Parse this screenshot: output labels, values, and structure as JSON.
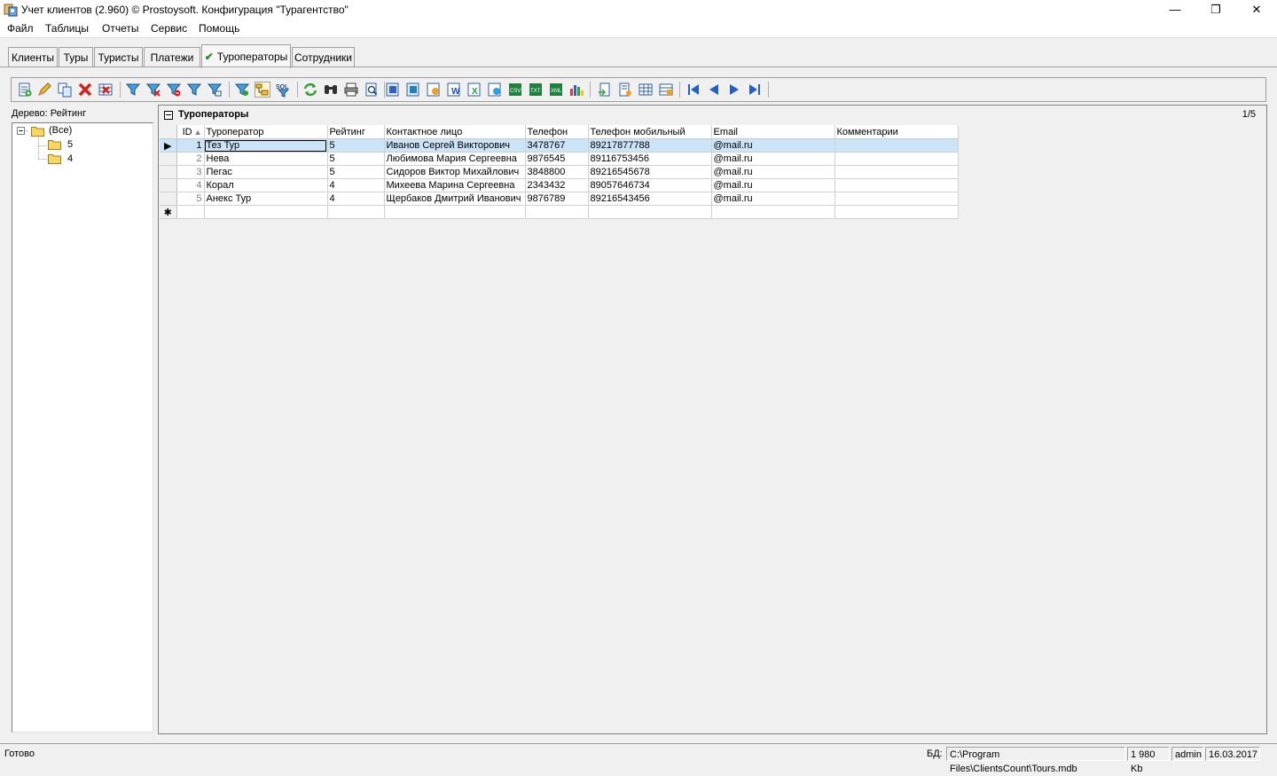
{
  "window": {
    "title": "Учет клиентов (2.960) © Prostoysoft. Конфигурация \"Турагентство\"",
    "minimize": "—",
    "maximize": "❐",
    "close": "✕"
  },
  "menu": [
    "Файл",
    "Таблицы",
    "Отчеты",
    "Сервис",
    "Помощь"
  ],
  "tabs": [
    {
      "label": "Клиенты",
      "active": false
    },
    {
      "label": "Туры",
      "active": false
    },
    {
      "label": "Туристы",
      "active": false
    },
    {
      "label": "Платежи",
      "active": false
    },
    {
      "label": "Туроператоры",
      "active": true
    },
    {
      "label": "Сотрудники",
      "active": false
    }
  ],
  "tab_check": "✔",
  "tree": {
    "label": "Дерево: Рейтинг",
    "root": "(Все)",
    "children": [
      "5",
      "4"
    ]
  },
  "grid": {
    "title": "Туроператоры",
    "count": "1/5",
    "columns": [
      "ID",
      "Туроператор",
      "Рейтинг",
      "Контактное лицо",
      "Телефон",
      "Телефон мобильный",
      "Email",
      "Комментарии"
    ],
    "sort_indicator": "▲",
    "rows": [
      [
        "1",
        "Тез Тур",
        "5",
        "Иванов Сергей Викторович",
        "3478767",
        "89217877788",
        "@mail.ru",
        ""
      ],
      [
        "2",
        "Нева",
        "5",
        "Любимова Мария Сергеевна",
        "9876545",
        "89116753456",
        "@mail.ru",
        ""
      ],
      [
        "3",
        "Пегас",
        "5",
        "Сидоров Виктор Михайлович",
        "3848800",
        "89216545678",
        "@mail.ru",
        ""
      ],
      [
        "4",
        "Корал",
        "4",
        "Михеева Марина Сергеевна",
        "2343432",
        "89057646734",
        "@mail.ru",
        ""
      ],
      [
        "5",
        "Анекс Тур",
        "4",
        "Щербаков Дмитрий Иванович",
        "9876789",
        "89216543456",
        "@mail.ru",
        ""
      ]
    ],
    "current_row_marker": "▶",
    "new_row_marker": "✱"
  },
  "status": {
    "ready": "Готово",
    "db_label": "БД:",
    "db_path": "C:\\Program Files\\ClientsCount\\Tours.mdb",
    "size": "1 980 Kb",
    "user": "admin",
    "date": "16.03.2017"
  },
  "toolbar_icons": [
    "add-record-icon",
    "edit-icon",
    "copy-icon",
    "delete-icon",
    "delete-all-icon",
    "filter-icon",
    "filter-remove-icon",
    "filter-clear-icon",
    "filter-advanced-icon",
    "filter-edit-icon",
    "filter-tree-icon",
    "tree-filter-icon",
    "sql-filter-icon",
    "refresh-icon",
    "find-icon",
    "print-icon",
    "preview-icon",
    "export-word-icon",
    "export-excel-icon",
    "export-html-icon",
    "export-csv-icon",
    "export-xml-icon",
    "export-txt-icon",
    "export-dbf-icon",
    "export-pdf-icon",
    "export-rtf-icon",
    "chart-icon",
    "import-icon",
    "import-excel-icon",
    "columns-icon",
    "settings-icon",
    "first-record-icon",
    "prev-record-icon",
    "next-record-icon",
    "last-record-icon"
  ],
  "colors": {
    "selected_row": "#cce4f7",
    "tab_check": "#2a8a2a",
    "delete_red": "#d62020",
    "nav_blue": "#2060c8"
  }
}
